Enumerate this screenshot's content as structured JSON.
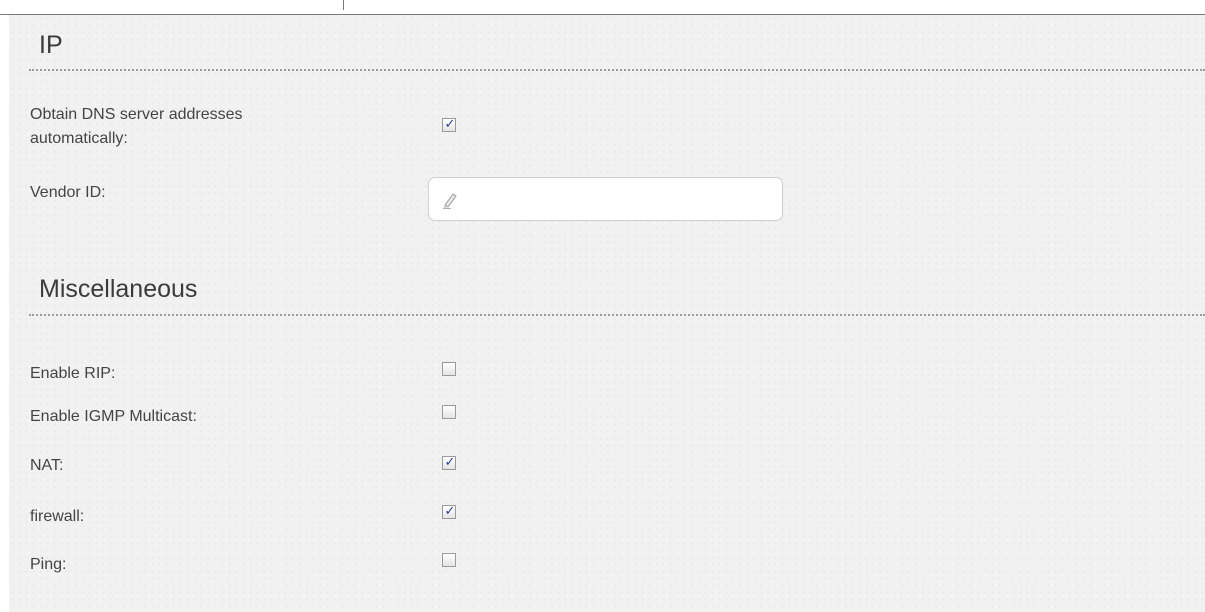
{
  "sections": {
    "ip": {
      "title": "IP",
      "dns_auto_label_line1": "Obtain DNS server addresses",
      "dns_auto_label_line2": "automatically:",
      "dns_auto_checked": true,
      "vendor_id_label": "Vendor ID:",
      "vendor_id_value": "",
      "vendor_id_icon": "pencil-icon"
    },
    "misc": {
      "title": "Miscellaneous",
      "rows": [
        {
          "label": "Enable RIP:",
          "checked": false
        },
        {
          "label": "Enable IGMP Multicast:",
          "checked": false
        },
        {
          "label": "NAT:",
          "checked": true
        },
        {
          "label": "firewall:",
          "checked": true
        },
        {
          "label": "Ping:",
          "checked": false
        }
      ]
    }
  },
  "colors": {
    "check_mark": "#2b3f8c",
    "panel_bg": "#f1f1f1",
    "text": "#444444"
  }
}
